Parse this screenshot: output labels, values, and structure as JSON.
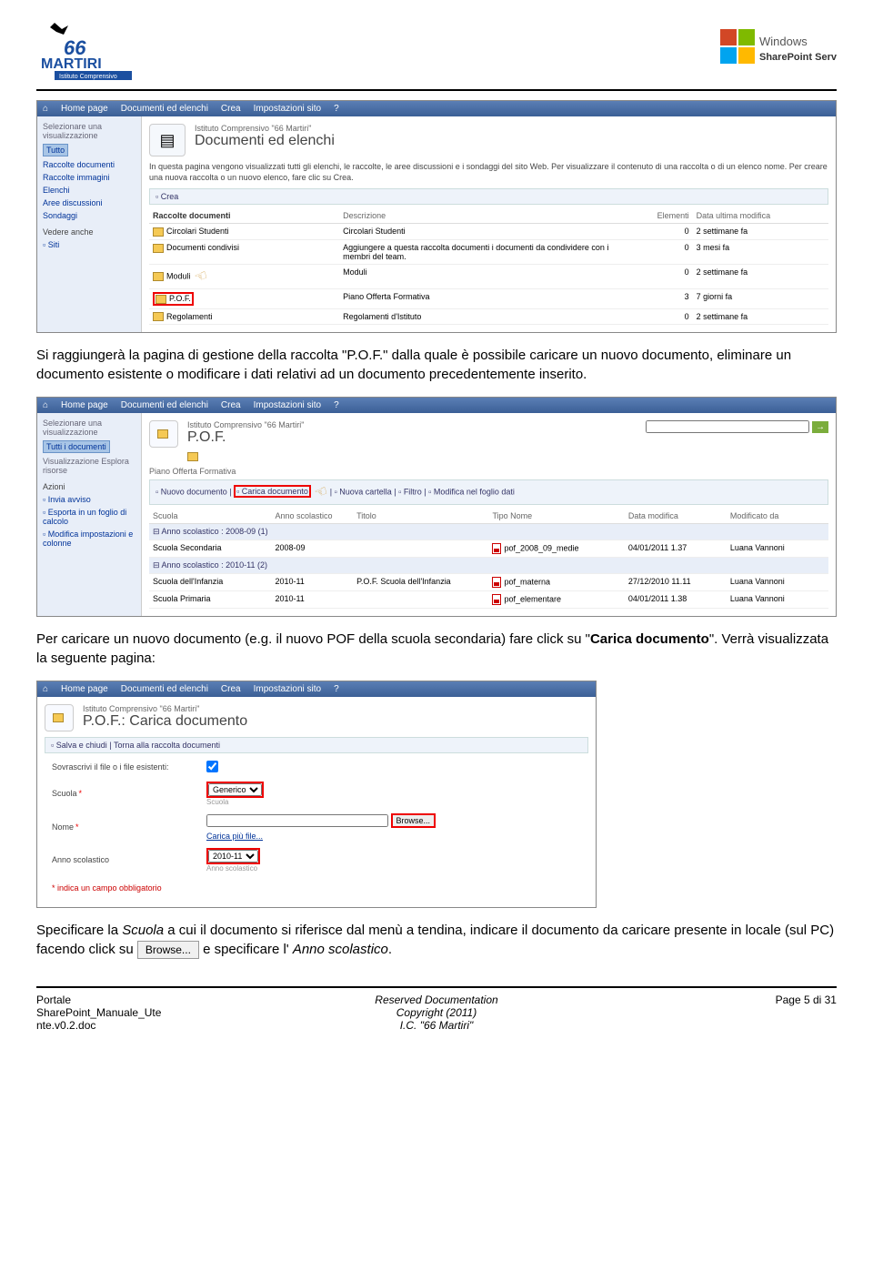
{
  "header": {
    "logo_left_name": "66 Martiri",
    "logo_left_sub": "Istituto Comprensivo",
    "logo_right_top": "Windows",
    "logo_right_bottom": "SharePoint Services"
  },
  "body": {
    "p1_a": "Si raggiungerà la pagina di gestione della raccolta \"P.O.F.\" dalla quale è possibile caricare un nuovo documento, eliminare un documento esistente o modificare i dati relativi ad un documento precedentemente inserito.",
    "p2_a": "Per caricare un nuovo documento (e.g. il nuovo POF della scuola secondaria) fare click su \"",
    "p2_bold": "Carica documento",
    "p2_b": "\". Verrà visualizzata la seguente pagina:",
    "p3_a": "Specificare la ",
    "p3_i1": "Scuola",
    "p3_b": " a cui il documento si riferisce dal menù a tendina, indicare il documento da caricare presente in locale (sul PC) facendo click su ",
    "p3_browse": "Browse...",
    "p3_c": " e specificare l' ",
    "p3_i2": "Anno scolastico",
    "p3_d": "."
  },
  "shot1": {
    "nav": [
      "Home page",
      "Documenti ed elenchi",
      "Crea",
      "Impostazioni sito",
      "?"
    ],
    "inst": "Istituto Comprensivo \"66 Martiri\"",
    "title": "Documenti ed elenchi",
    "desc": "In questa pagina vengono visualizzati tutti gli elenchi, le raccolte, le aree discussioni e i sondaggi del sito Web. Per visualizzare il contenuto di una raccolta o di un elenco nome. Per creare una nuova raccolta o un nuovo elenco, fare clic su Crea.",
    "crea": "Crea",
    "side_hdr": "Selezionare una visualizzazione",
    "side": [
      "Tutto",
      "Raccolte documenti",
      "Raccolte immagini",
      "Elenchi",
      "Aree discussioni",
      "Sondaggi"
    ],
    "side_hdr2": "Vedere anche",
    "side2": "Siti",
    "cols": [
      "Raccolte documenti",
      "Descrizione",
      "Elementi",
      "Data ultima modifica"
    ],
    "rows": [
      {
        "n": "Circolari Studenti",
        "d": "Circolari Studenti",
        "e": "0",
        "m": "2 settimane fa"
      },
      {
        "n": "Documenti condivisi",
        "d": "Aggiungere a questa raccolta documenti i documenti da condividere con i membri del team.",
        "e": "0",
        "m": "3 mesi fa"
      },
      {
        "n": "Moduli",
        "d": "Moduli",
        "e": "0",
        "m": "2 settimane fa"
      },
      {
        "n": "P.O.F.",
        "d": "Piano Offerta Formativa",
        "e": "3",
        "m": "7 giorni fa"
      },
      {
        "n": "Regolamenti",
        "d": "Regolamenti d'Istituto",
        "e": "0",
        "m": "2 settimane fa"
      }
    ]
  },
  "shot2": {
    "nav": [
      "Home page",
      "Documenti ed elenchi",
      "Crea",
      "Impostazioni sito",
      "?"
    ],
    "inst": "Istituto Comprensivo \"66 Martiri\"",
    "title": "P.O.F.",
    "sub": "Piano Offerta Formativa",
    "toolbar": [
      "Nuovo documento",
      "Carica documento",
      "Nuova cartella",
      "Filtro",
      "Modifica nel foglio dati"
    ],
    "side_hdr": "Selezionare una visualizzazione",
    "side": [
      "Tutti i documenti"
    ],
    "side_v": "Visualizzazione Esplora risorse",
    "side_hdr2": "Azioni",
    "side2": [
      "Invia avviso",
      "Esporta in un foglio di calcolo",
      "Modifica impostazioni e colonne"
    ],
    "cols": [
      "Scuola",
      "Anno scolastico",
      "Titolo",
      "Tipo Nome",
      "Data modifica",
      "Modificato da"
    ],
    "groups": [
      {
        "h": "Anno scolastico : 2008-09 (1)",
        "rows": [
          {
            "s": "Scuola Secondaria",
            "a": "2008-09",
            "t": "",
            "n": "pof_2008_09_medie",
            "d": "04/01/2011 1.37",
            "u": "Luana Vannoni"
          }
        ]
      },
      {
        "h": "Anno scolastico : 2010-11 (2)",
        "rows": [
          {
            "s": "Scuola dell'Infanzia",
            "a": "2010-11",
            "t": "P.O.F. Scuola dell'Infanzia",
            "n": "pof_materna",
            "d": "27/12/2010 11.11",
            "u": "Luana Vannoni"
          },
          {
            "s": "Scuola Primaria",
            "a": "2010-11",
            "t": "",
            "n": "pof_elementare",
            "d": "04/01/2011 1.38",
            "u": "Luana Vannoni"
          }
        ]
      }
    ]
  },
  "shot3": {
    "nav": [
      "Home page",
      "Documenti ed elenchi",
      "Crea",
      "Impostazioni sito",
      "?"
    ],
    "inst": "Istituto Comprensivo \"66 Martiri\"",
    "title": "P.O.F.: Carica documento",
    "toolbar": [
      "Salva e chiudi",
      "Torna alla raccolta documenti"
    ],
    "overwrite_lbl": "Sovrascrivi il file o i file esistenti:",
    "scuola_lbl": "Scuola",
    "scuola_val": "Generico",
    "scuola_note": "Scuola",
    "nome_lbl": "Nome",
    "browse": "Browse...",
    "multi": "Carica più file...",
    "anno_lbl": "Anno scolastico",
    "anno_val": "2010-11",
    "anno_note": "Anno scolastico",
    "req": "* indica un campo obbligatorio"
  },
  "footer": {
    "l1": "Portale",
    "l2": "SharePoint_Manuale_Ute",
    "l3": "nte.v0.2.doc",
    "c1": "Reserved Documentation",
    "c2": "Copyright (2011)",
    "c3": "I.C. \"66 Martiri\"",
    "r": "Page 5 di 31"
  }
}
